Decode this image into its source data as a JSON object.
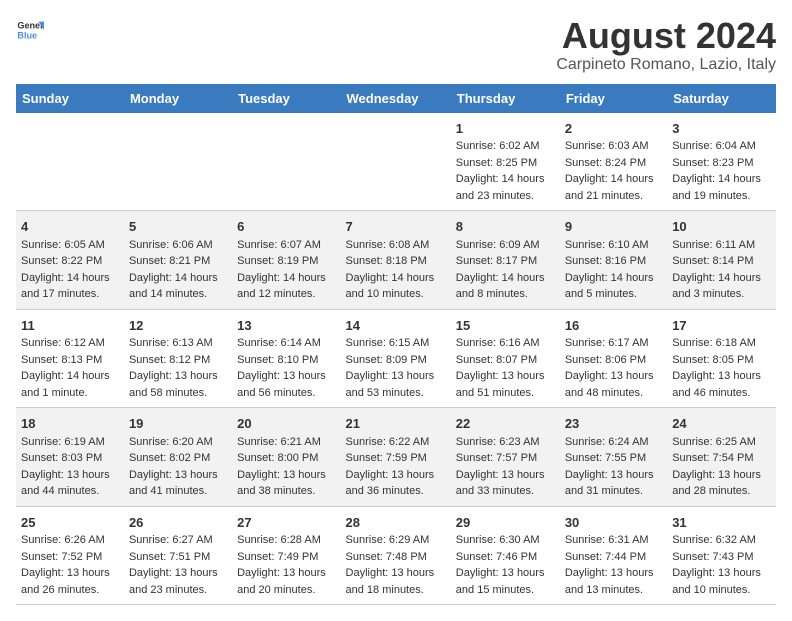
{
  "header": {
    "logo_line1": "General",
    "logo_line2": "Blue",
    "month_year": "August 2024",
    "location": "Carpineto Romano, Lazio, Italy"
  },
  "days_of_week": [
    "Sunday",
    "Monday",
    "Tuesday",
    "Wednesday",
    "Thursday",
    "Friday",
    "Saturday"
  ],
  "weeks": [
    [
      {
        "day": "",
        "content": ""
      },
      {
        "day": "",
        "content": ""
      },
      {
        "day": "",
        "content": ""
      },
      {
        "day": "",
        "content": ""
      },
      {
        "day": "1",
        "content": "Sunrise: 6:02 AM\nSunset: 8:25 PM\nDaylight: 14 hours and 23 minutes."
      },
      {
        "day": "2",
        "content": "Sunrise: 6:03 AM\nSunset: 8:24 PM\nDaylight: 14 hours and 21 minutes."
      },
      {
        "day": "3",
        "content": "Sunrise: 6:04 AM\nSunset: 8:23 PM\nDaylight: 14 hours and 19 minutes."
      }
    ],
    [
      {
        "day": "4",
        "content": "Sunrise: 6:05 AM\nSunset: 8:22 PM\nDaylight: 14 hours and 17 minutes."
      },
      {
        "day": "5",
        "content": "Sunrise: 6:06 AM\nSunset: 8:21 PM\nDaylight: 14 hours and 14 minutes."
      },
      {
        "day": "6",
        "content": "Sunrise: 6:07 AM\nSunset: 8:19 PM\nDaylight: 14 hours and 12 minutes."
      },
      {
        "day": "7",
        "content": "Sunrise: 6:08 AM\nSunset: 8:18 PM\nDaylight: 14 hours and 10 minutes."
      },
      {
        "day": "8",
        "content": "Sunrise: 6:09 AM\nSunset: 8:17 PM\nDaylight: 14 hours and 8 minutes."
      },
      {
        "day": "9",
        "content": "Sunrise: 6:10 AM\nSunset: 8:16 PM\nDaylight: 14 hours and 5 minutes."
      },
      {
        "day": "10",
        "content": "Sunrise: 6:11 AM\nSunset: 8:14 PM\nDaylight: 14 hours and 3 minutes."
      }
    ],
    [
      {
        "day": "11",
        "content": "Sunrise: 6:12 AM\nSunset: 8:13 PM\nDaylight: 14 hours and 1 minute."
      },
      {
        "day": "12",
        "content": "Sunrise: 6:13 AM\nSunset: 8:12 PM\nDaylight: 13 hours and 58 minutes."
      },
      {
        "day": "13",
        "content": "Sunrise: 6:14 AM\nSunset: 8:10 PM\nDaylight: 13 hours and 56 minutes."
      },
      {
        "day": "14",
        "content": "Sunrise: 6:15 AM\nSunset: 8:09 PM\nDaylight: 13 hours and 53 minutes."
      },
      {
        "day": "15",
        "content": "Sunrise: 6:16 AM\nSunset: 8:07 PM\nDaylight: 13 hours and 51 minutes."
      },
      {
        "day": "16",
        "content": "Sunrise: 6:17 AM\nSunset: 8:06 PM\nDaylight: 13 hours and 48 minutes."
      },
      {
        "day": "17",
        "content": "Sunrise: 6:18 AM\nSunset: 8:05 PM\nDaylight: 13 hours and 46 minutes."
      }
    ],
    [
      {
        "day": "18",
        "content": "Sunrise: 6:19 AM\nSunset: 8:03 PM\nDaylight: 13 hours and 44 minutes."
      },
      {
        "day": "19",
        "content": "Sunrise: 6:20 AM\nSunset: 8:02 PM\nDaylight: 13 hours and 41 minutes."
      },
      {
        "day": "20",
        "content": "Sunrise: 6:21 AM\nSunset: 8:00 PM\nDaylight: 13 hours and 38 minutes."
      },
      {
        "day": "21",
        "content": "Sunrise: 6:22 AM\nSunset: 7:59 PM\nDaylight: 13 hours and 36 minutes."
      },
      {
        "day": "22",
        "content": "Sunrise: 6:23 AM\nSunset: 7:57 PM\nDaylight: 13 hours and 33 minutes."
      },
      {
        "day": "23",
        "content": "Sunrise: 6:24 AM\nSunset: 7:55 PM\nDaylight: 13 hours and 31 minutes."
      },
      {
        "day": "24",
        "content": "Sunrise: 6:25 AM\nSunset: 7:54 PM\nDaylight: 13 hours and 28 minutes."
      }
    ],
    [
      {
        "day": "25",
        "content": "Sunrise: 6:26 AM\nSunset: 7:52 PM\nDaylight: 13 hours and 26 minutes."
      },
      {
        "day": "26",
        "content": "Sunrise: 6:27 AM\nSunset: 7:51 PM\nDaylight: 13 hours and 23 minutes."
      },
      {
        "day": "27",
        "content": "Sunrise: 6:28 AM\nSunset: 7:49 PM\nDaylight: 13 hours and 20 minutes."
      },
      {
        "day": "28",
        "content": "Sunrise: 6:29 AM\nSunset: 7:48 PM\nDaylight: 13 hours and 18 minutes."
      },
      {
        "day": "29",
        "content": "Sunrise: 6:30 AM\nSunset: 7:46 PM\nDaylight: 13 hours and 15 minutes."
      },
      {
        "day": "30",
        "content": "Sunrise: 6:31 AM\nSunset: 7:44 PM\nDaylight: 13 hours and 13 minutes."
      },
      {
        "day": "31",
        "content": "Sunrise: 6:32 AM\nSunset: 7:43 PM\nDaylight: 13 hours and 10 minutes."
      }
    ]
  ]
}
